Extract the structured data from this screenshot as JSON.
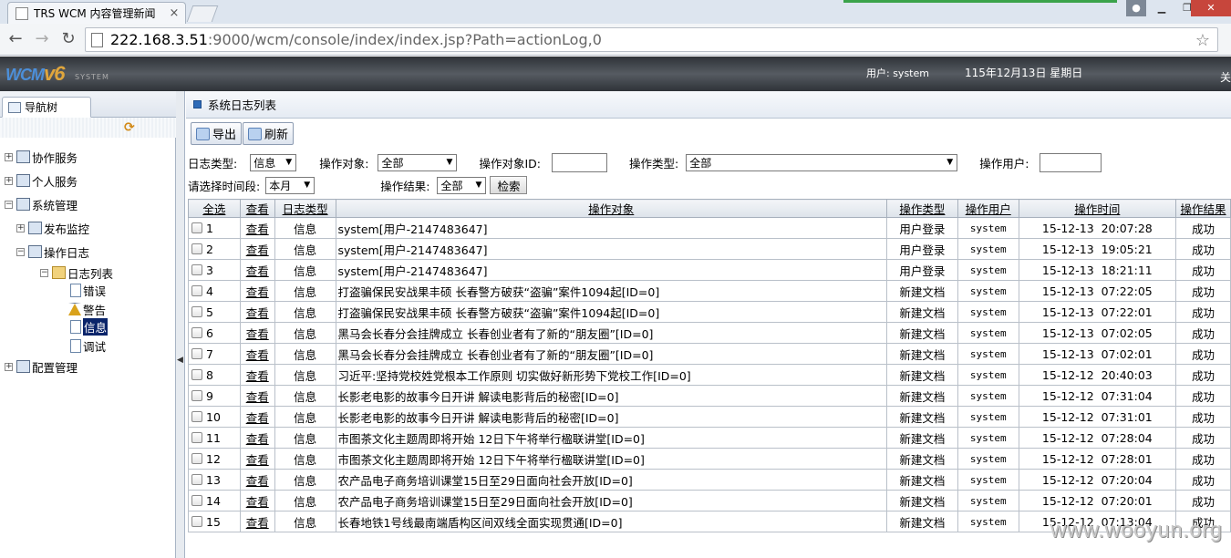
{
  "browser": {
    "tab_title": "TRS WCM 内容管理新闻",
    "tab_close": "×",
    "url_host": "222.168.3.51",
    "url_rest": ":9000/wcm/console/index/index.jsp?Path=actionLog,0",
    "back": "←",
    "forward": "→",
    "reload": "↻",
    "star": "☆",
    "minimize": "▁",
    "maximize": "❐",
    "close": "✕",
    "user_icon": "person-icon"
  },
  "header": {
    "logo_wcm": "WCM",
    "logo_v6": "v6",
    "logo_system": "SYSTEM",
    "user_label": "用户: system",
    "date": "115年12月13日 星期日",
    "right_text": "关"
  },
  "nav": {
    "tab_label": "导航树",
    "tree": {
      "collab": "协作服务",
      "personal": "个人服务",
      "sysmgmt": "系统管理",
      "publish_monitor": "发布监控",
      "oplog": "操作日志",
      "loglist": "日志列表",
      "error": "错误",
      "warning": "警告",
      "info": "信息",
      "debug": "调试",
      "config": "配置管理"
    }
  },
  "main": {
    "title": "系统日志列表",
    "export_label": "导出",
    "refresh_label": "刷新",
    "filters": {
      "log_type_label": "日志类型:",
      "log_type_value": "信息",
      "op_object_label": "操作对象:",
      "op_object_value": "全部",
      "op_object_id_label": "操作对象ID:",
      "op_type_label": "操作类型:",
      "op_type_value": "全部",
      "op_user_label": "操作用户:",
      "period_label": "请选择时间段:",
      "period_value": "本月",
      "result_label": "操作结果:",
      "result_value": "全部",
      "search_label": "检索"
    },
    "columns": [
      "全选",
      "查看",
      "日志类型",
      "操作对象",
      "操作类型",
      "操作用户",
      "操作时间",
      "操作结果"
    ],
    "rows": [
      {
        "n": "1",
        "view": "查看",
        "type": "信息",
        "obj": "system[用户-2147483647]",
        "op": "用户登录",
        "user": "system",
        "time": "15-12-13  20:07:28",
        "result": "成功"
      },
      {
        "n": "2",
        "view": "查看",
        "type": "信息",
        "obj": "system[用户-2147483647]",
        "op": "用户登录",
        "user": "system",
        "time": "15-12-13  19:05:21",
        "result": "成功"
      },
      {
        "n": "3",
        "view": "查看",
        "type": "信息",
        "obj": "system[用户-2147483647]",
        "op": "用户登录",
        "user": "system",
        "time": "15-12-13  18:21:11",
        "result": "成功"
      },
      {
        "n": "4",
        "view": "查看",
        "type": "信息",
        "obj": "打盗骗保民安战果丰硕  长春警方破获“盗骗”案件1094起[ID=0]",
        "op": "新建文档",
        "user": "system",
        "time": "15-12-13  07:22:05",
        "result": "成功"
      },
      {
        "n": "5",
        "view": "查看",
        "type": "信息",
        "obj": "打盗骗保民安战果丰硕  长春警方破获“盗骗”案件1094起[ID=0]",
        "op": "新建文档",
        "user": "system",
        "time": "15-12-13  07:22:01",
        "result": "成功"
      },
      {
        "n": "6",
        "view": "查看",
        "type": "信息",
        "obj": "黑马会长春分会挂牌成立  长春创业者有了新的“朋友圈”[ID=0]",
        "op": "新建文档",
        "user": "system",
        "time": "15-12-13  07:02:05",
        "result": "成功"
      },
      {
        "n": "7",
        "view": "查看",
        "type": "信息",
        "obj": "黑马会长春分会挂牌成立  长春创业者有了新的“朋友圈”[ID=0]",
        "op": "新建文档",
        "user": "system",
        "time": "15-12-13  07:02:01",
        "result": "成功"
      },
      {
        "n": "8",
        "view": "查看",
        "type": "信息",
        "obj": "习近平:坚持党校姓党根本工作原则  切实做好新形势下党校工作[ID=0]",
        "op": "新建文档",
        "user": "system",
        "time": "15-12-12  20:40:03",
        "result": "成功"
      },
      {
        "n": "9",
        "view": "查看",
        "type": "信息",
        "obj": "长影老电影的故事今日开讲  解读电影背后的秘密[ID=0]",
        "op": "新建文档",
        "user": "system",
        "time": "15-12-12  07:31:04",
        "result": "成功"
      },
      {
        "n": "10",
        "view": "查看",
        "type": "信息",
        "obj": "长影老电影的故事今日开讲  解读电影背后的秘密[ID=0]",
        "op": "新建文档",
        "user": "system",
        "time": "15-12-12  07:31:01",
        "result": "成功"
      },
      {
        "n": "11",
        "view": "查看",
        "type": "信息",
        "obj": "市图茶文化主题周即将开始  12日下午将举行楹联讲堂[ID=0]",
        "op": "新建文档",
        "user": "system",
        "time": "15-12-12  07:28:04",
        "result": "成功"
      },
      {
        "n": "12",
        "view": "查看",
        "type": "信息",
        "obj": "市图茶文化主题周即将开始  12日下午将举行楹联讲堂[ID=0]",
        "op": "新建文档",
        "user": "system",
        "time": "15-12-12  07:28:01",
        "result": "成功"
      },
      {
        "n": "13",
        "view": "查看",
        "type": "信息",
        "obj": "农产品电子商务培训课堂15日至29日面向社会开放[ID=0]",
        "op": "新建文档",
        "user": "system",
        "time": "15-12-12  07:20:04",
        "result": "成功"
      },
      {
        "n": "14",
        "view": "查看",
        "type": "信息",
        "obj": "农产品电子商务培训课堂15日至29日面向社会开放[ID=0]",
        "op": "新建文档",
        "user": "system",
        "time": "15-12-12  07:20:01",
        "result": "成功"
      },
      {
        "n": "15",
        "view": "查看",
        "type": "信息",
        "obj": "长春地铁1号线最南端盾构区间双线全面实现贯通[ID=0]",
        "op": "新建文档",
        "user": "system",
        "time": "15-12-12  07:13:04",
        "result": "成功"
      }
    ]
  },
  "watermark": "www.wooyun.org"
}
